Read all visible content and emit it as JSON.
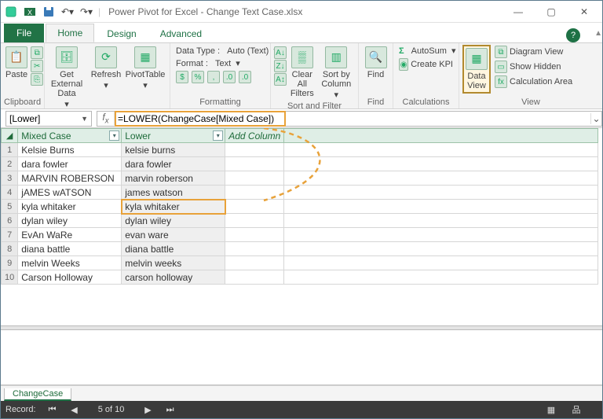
{
  "title": "Power Pivot for Excel - Change Text Case.xlsx",
  "tabs": {
    "file": "File",
    "home": "Home",
    "design": "Design",
    "advanced": "Advanced"
  },
  "ribbon": {
    "clipboard": {
      "paste": "Paste",
      "label": "Clipboard"
    },
    "getdata": {
      "btn": "Get External Data",
      "refresh": "Refresh",
      "pivot": "PivotTable"
    },
    "formatting": {
      "datatype_label": "Data Type :",
      "datatype_value": "Auto (Text)",
      "format_label": "Format :",
      "format_value": "Text",
      "label": "Formatting"
    },
    "sortfilter": {
      "clear": "Clear All Filters",
      "sortby": "Sort by Column",
      "label": "Sort and Filter"
    },
    "find": {
      "btn": "Find",
      "label": "Find"
    },
    "calc": {
      "autosum": "AutoSum",
      "kpi": "Create KPI",
      "label": "Calculations"
    },
    "view": {
      "dataview": "Data View",
      "diagram": "Diagram View",
      "hidden": "Show Hidden",
      "calcarea": "Calculation Area",
      "label": "View"
    }
  },
  "namebox": "[Lower]",
  "formula": "=LOWER(ChangeCase[Mixed Case])",
  "columns": {
    "mixed": "Mixed Case",
    "lower": "Lower",
    "add": "Add Column"
  },
  "rows": [
    {
      "n": "1",
      "mixed": "Kelsie Burns",
      "lower": "kelsie burns"
    },
    {
      "n": "2",
      "mixed": "dara fowler",
      "lower": "dara fowler"
    },
    {
      "n": "3",
      "mixed": "MARVIN ROBERSON",
      "lower": "marvin roberson"
    },
    {
      "n": "4",
      "mixed": "jAMES wATSON",
      "lower": "james watson"
    },
    {
      "n": "5",
      "mixed": "kyla whitaker",
      "lower": "kyla whitaker"
    },
    {
      "n": "6",
      "mixed": "dylan wiley",
      "lower": "dylan wiley"
    },
    {
      "n": "7",
      "mixed": "EvAn WaRe",
      "lower": "evan ware"
    },
    {
      "n": "8",
      "mixed": "diana battle",
      "lower": "diana battle"
    },
    {
      "n": "9",
      "mixed": "melvin Weeks",
      "lower": "melvin weeks"
    },
    {
      "n": "10",
      "mixed": "Carson Holloway",
      "lower": "carson holloway"
    }
  ],
  "selected_row_index": 4,
  "sheet": "ChangeCase",
  "status": {
    "record": "Record:",
    "pos": "5 of 10"
  }
}
